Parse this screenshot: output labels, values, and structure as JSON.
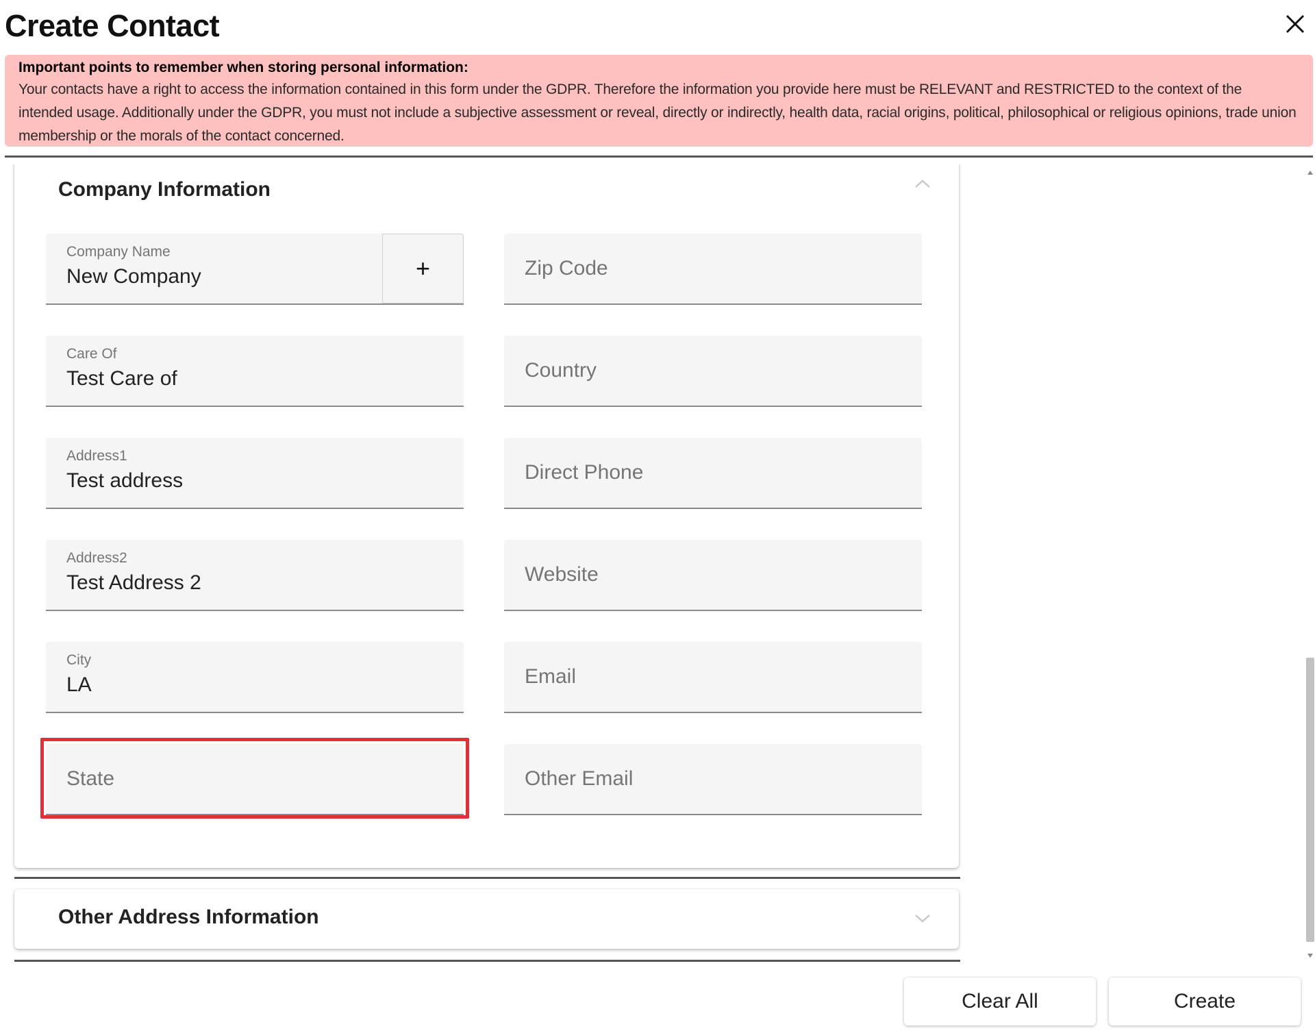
{
  "dialog": {
    "title": "Create Contact",
    "close_icon": "close-icon"
  },
  "notice": {
    "heading": "Important points to remember when storing personal information:",
    "body": "Your contacts have a right to access the information contained in this form under the GDPR. Therefore the information you provide here must be RELEVANT and RESTRICTED to the context of the intended usage. Additionally under the GDPR, you must not include a subjective assessment or reveal, directly or indirectly, health data, racial origins, political, philosophical or religious opinions, trade union membership or the morals of the contact concerned.",
    "background_color": "#ffc0c0"
  },
  "company_section": {
    "title": "Company Information",
    "expanded": true,
    "left_fields": [
      {
        "label": "Company Name",
        "value": "New Company",
        "add_label": "+"
      },
      {
        "label": "Care Of",
        "value": "Test Care of"
      },
      {
        "label": "Address1",
        "value": "Test address"
      },
      {
        "label": "Address2",
        "value": "Test Address 2"
      },
      {
        "label": "City",
        "value": "LA"
      },
      {
        "label": "",
        "value": "",
        "placeholder": "State"
      }
    ],
    "right_fields": [
      {
        "placeholder": "Zip Code"
      },
      {
        "placeholder": "Country"
      },
      {
        "placeholder": "Direct Phone"
      },
      {
        "placeholder": "Website"
      },
      {
        "placeholder": "Email"
      },
      {
        "placeholder": "Other Email"
      }
    ]
  },
  "other_address_section": {
    "title": "Other Address Information",
    "expanded": false
  },
  "footer": {
    "clear_label": "Clear All",
    "create_label": "Create"
  },
  "highlight_color": "#e0303a"
}
